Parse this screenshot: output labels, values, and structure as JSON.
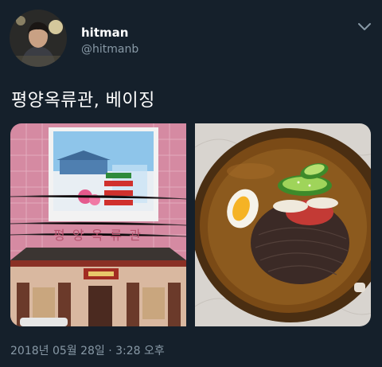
{
  "user": {
    "display_name": "hitman",
    "handle": "@hitmanb"
  },
  "tweet": {
    "text": "평양옥류관, 베이징",
    "timestamp": "2018년 05월 28일 · 3:28 오후"
  },
  "media": {
    "photos": [
      {
        "subject": "restaurant-building",
        "sign_text": "평 양 옥 류 관"
      },
      {
        "subject": "cold-noodles-bowl"
      }
    ]
  },
  "icons": {
    "more": "chevron-down-icon"
  },
  "colors": {
    "background": "#15202b",
    "primary_text": "#ffffff",
    "secondary_text": "#8899a6"
  }
}
